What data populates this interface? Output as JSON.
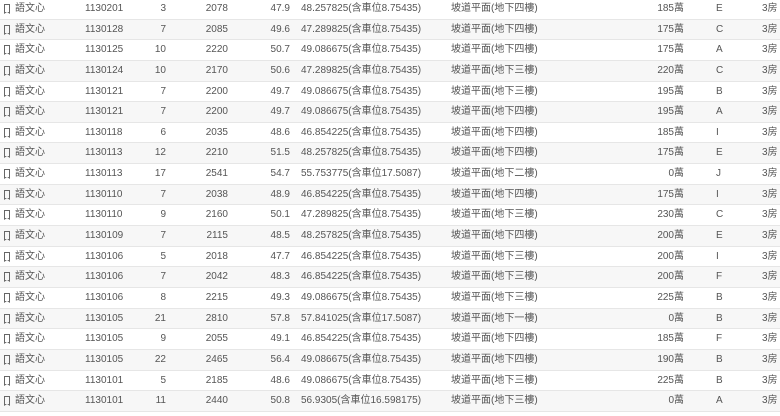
{
  "rows": [
    {
      "name": "語文心",
      "date": "1130201",
      "floor": "3",
      "total": "2078",
      "area": "47.9",
      "unit": "48.257825(含車位8.75435)",
      "park": "坡道平面(地下四樓)",
      "price": "185萬",
      "grade": "E",
      "note": "3房"
    },
    {
      "name": "語文心",
      "date": "1130128",
      "floor": "7",
      "total": "2085",
      "area": "49.6",
      "unit": "47.289825(含車位8.75435)",
      "park": "坡道平面(地下四樓)",
      "price": "175萬",
      "grade": "C",
      "note": "3房"
    },
    {
      "name": "語文心",
      "date": "1130125",
      "floor": "10",
      "total": "2220",
      "area": "50.7",
      "unit": "49.086675(含車位8.75435)",
      "park": "坡道平面(地下四樓)",
      "price": "175萬",
      "grade": "A",
      "note": "3房"
    },
    {
      "name": "語文心",
      "date": "1130124",
      "floor": "10",
      "total": "2170",
      "area": "50.6",
      "unit": "47.289825(含車位8.75435)",
      "park": "坡道平面(地下三樓)",
      "price": "220萬",
      "grade": "C",
      "note": "3房"
    },
    {
      "name": "語文心",
      "date": "1130121",
      "floor": "7",
      "total": "2200",
      "area": "49.7",
      "unit": "49.086675(含車位8.75435)",
      "park": "坡道平面(地下三樓)",
      "price": "195萬",
      "grade": "B",
      "note": "3房"
    },
    {
      "name": "語文心",
      "date": "1130121",
      "floor": "7",
      "total": "2200",
      "area": "49.7",
      "unit": "49.086675(含車位8.75435)",
      "park": "坡道平面(地下四樓)",
      "price": "195萬",
      "grade": "A",
      "note": "3房"
    },
    {
      "name": "語文心",
      "date": "1130118",
      "floor": "6",
      "total": "2035",
      "area": "48.6",
      "unit": "46.854225(含車位8.75435)",
      "park": "坡道平面(地下四樓)",
      "price": "185萬",
      "grade": "I",
      "note": "3房"
    },
    {
      "name": "語文心",
      "date": "1130113",
      "floor": "12",
      "total": "2210",
      "area": "51.5",
      "unit": "48.257825(含車位8.75435)",
      "park": "坡道平面(地下四樓)",
      "price": "175萬",
      "grade": "E",
      "note": "3房"
    },
    {
      "name": "語文心",
      "date": "1130113",
      "floor": "17",
      "total": "2541",
      "area": "54.7",
      "unit": "55.753775(含車位17.5087)",
      "park": "坡道平面(地下二樓)",
      "price": "0萬",
      "grade": "J",
      "note": "3房"
    },
    {
      "name": "語文心",
      "date": "1130110",
      "floor": "7",
      "total": "2038",
      "area": "48.9",
      "unit": "46.854225(含車位8.75435)",
      "park": "坡道平面(地下四樓)",
      "price": "175萬",
      "grade": "I",
      "note": "3房"
    },
    {
      "name": "語文心",
      "date": "1130110",
      "floor": "9",
      "total": "2160",
      "area": "50.1",
      "unit": "47.289825(含車位8.75435)",
      "park": "坡道平面(地下三樓)",
      "price": "230萬",
      "grade": "C",
      "note": "3房"
    },
    {
      "name": "語文心",
      "date": "1130109",
      "floor": "7",
      "total": "2115",
      "area": "48.5",
      "unit": "48.257825(含車位8.75435)",
      "park": "坡道平面(地下四樓)",
      "price": "200萬",
      "grade": "E",
      "note": "3房"
    },
    {
      "name": "語文心",
      "date": "1130106",
      "floor": "5",
      "total": "2018",
      "area": "47.7",
      "unit": "46.854225(含車位8.75435)",
      "park": "坡道平面(地下三樓)",
      "price": "200萬",
      "grade": "I",
      "note": "3房"
    },
    {
      "name": "語文心",
      "date": "1130106",
      "floor": "7",
      "total": "2042",
      "area": "48.3",
      "unit": "46.854225(含車位8.75435)",
      "park": "坡道平面(地下三樓)",
      "price": "200萬",
      "grade": "F",
      "note": "3房"
    },
    {
      "name": "語文心",
      "date": "1130106",
      "floor": "8",
      "total": "2215",
      "area": "49.3",
      "unit": "49.086675(含車位8.75435)",
      "park": "坡道平面(地下三樓)",
      "price": "225萬",
      "grade": "B",
      "note": "3房"
    },
    {
      "name": "語文心",
      "date": "1130105",
      "floor": "21",
      "total": "2810",
      "area": "57.8",
      "unit": "57.841025(含車位17.5087)",
      "park": "坡道平面(地下一樓)",
      "price": "0萬",
      "grade": "B",
      "note": "3房"
    },
    {
      "name": "語文心",
      "date": "1130105",
      "floor": "9",
      "total": "2055",
      "area": "49.1",
      "unit": "46.854225(含車位8.75435)",
      "park": "坡道平面(地下四樓)",
      "price": "185萬",
      "grade": "F",
      "note": "3房"
    },
    {
      "name": "語文心",
      "date": "1130105",
      "floor": "22",
      "total": "2465",
      "area": "56.4",
      "unit": "49.086675(含車位8.75435)",
      "park": "坡道平面(地下四樓)",
      "price": "190萬",
      "grade": "B",
      "note": "3房"
    },
    {
      "name": "語文心",
      "date": "1130101",
      "floor": "5",
      "total": "2185",
      "area": "48.6",
      "unit": "49.086675(含車位8.75435)",
      "park": "坡道平面(地下三樓)",
      "price": "225萬",
      "grade": "B",
      "note": "3房"
    },
    {
      "name": "語文心",
      "date": "1130101",
      "floor": "11",
      "total": "2440",
      "area": "50.8",
      "unit": "56.9305(含車位16.598175)",
      "park": "坡道平面(地下三樓)",
      "price": "0萬",
      "grade": "A",
      "note": "3房"
    }
  ]
}
